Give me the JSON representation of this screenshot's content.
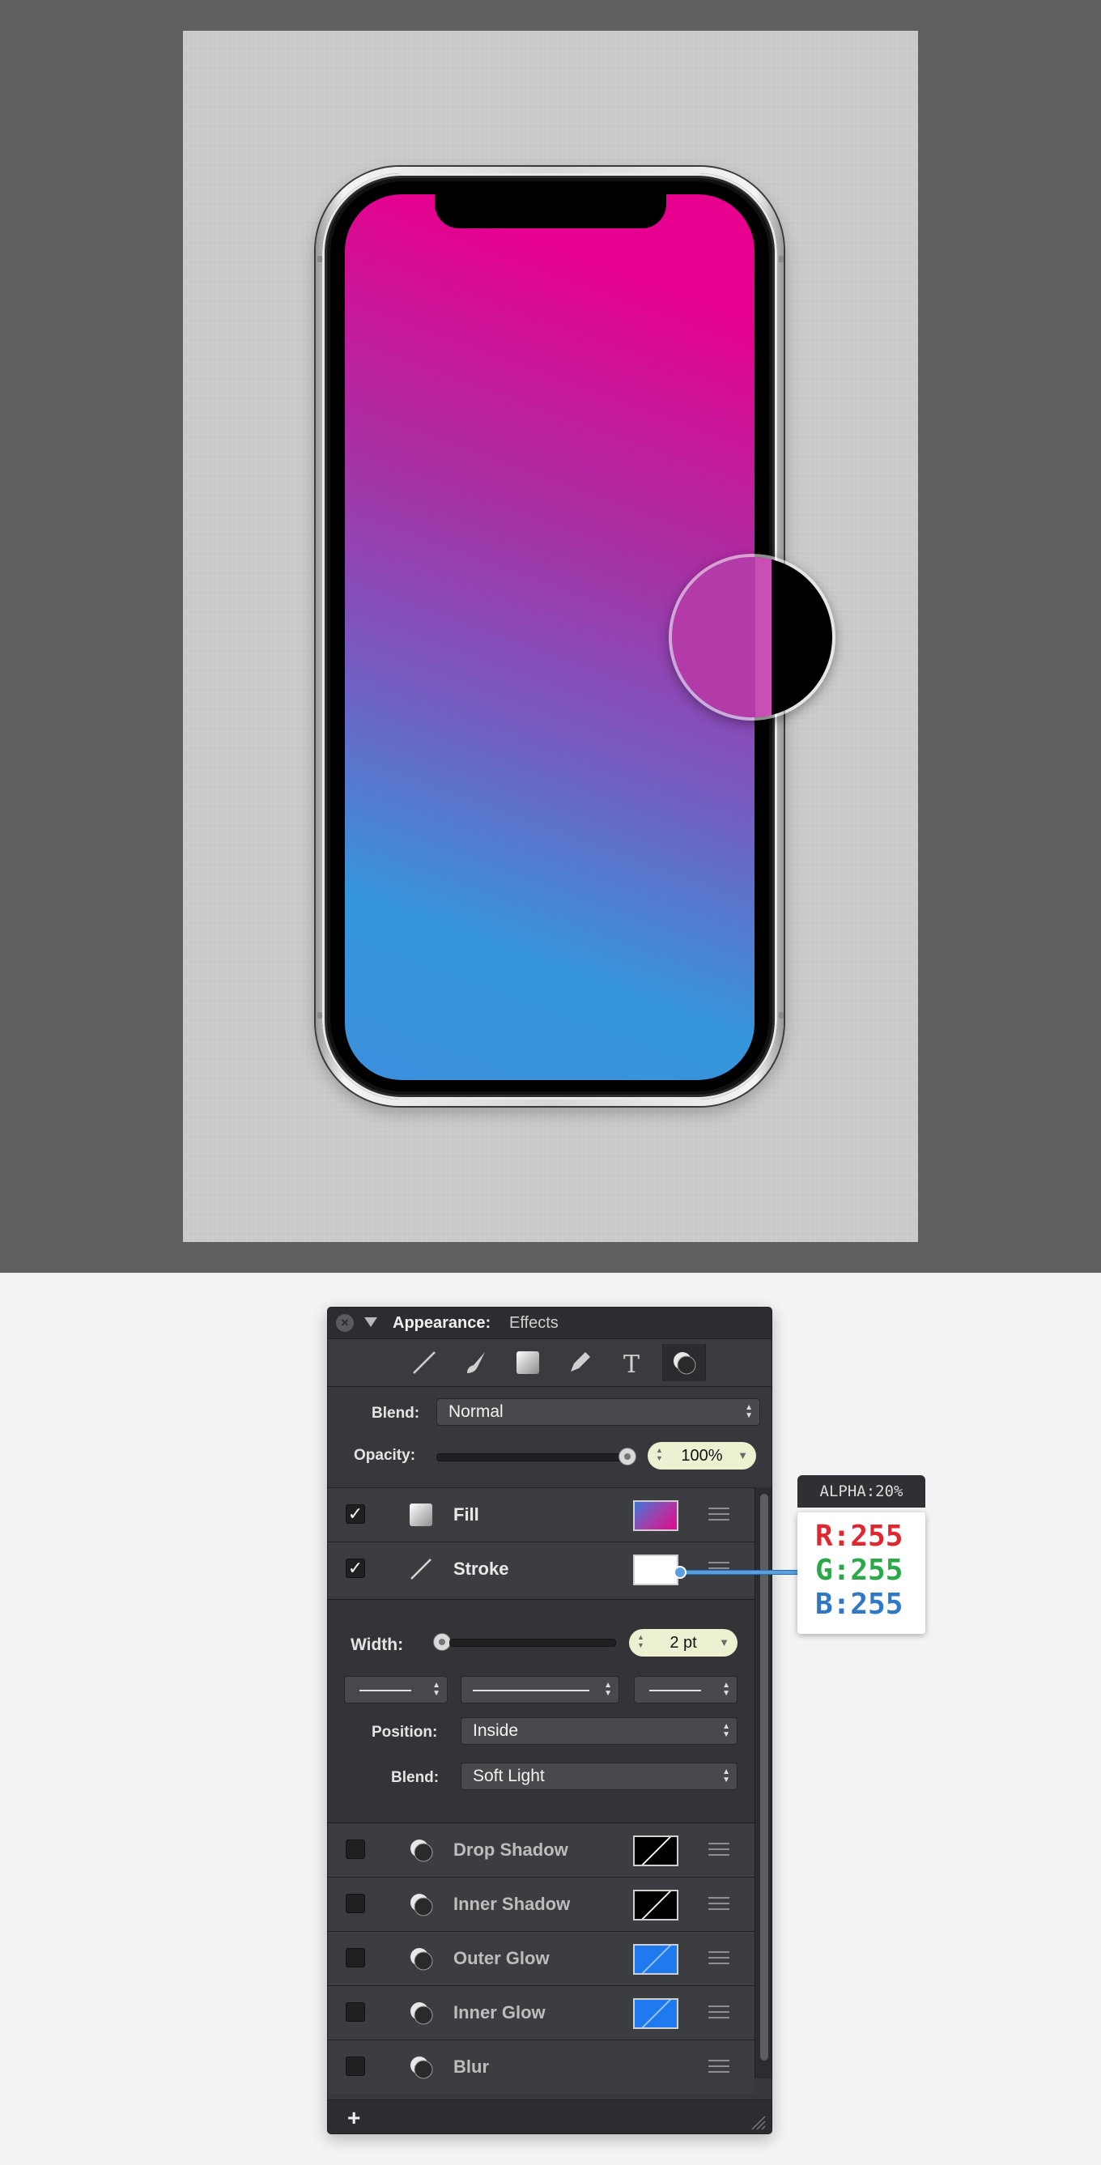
{
  "panel": {
    "title_label": "Appearance:",
    "title_value": "Effects",
    "tools": [
      "stroke-tool-icon",
      "brush-tool-icon",
      "fill-tool-icon",
      "pencil-tool-icon",
      "text-tool-icon",
      "effects-tool-icon"
    ],
    "blend_label": "Blend:",
    "blend_value": "Normal",
    "opacity_label": "Opacity:",
    "opacity_value": "100%",
    "opacity_level": 1.0,
    "rows": {
      "fill": {
        "name": "Fill",
        "checked": true
      },
      "stroke": {
        "name": "Stroke",
        "checked": true
      }
    },
    "stroke_settings": {
      "width_label": "Width:",
      "width_value": "2 pt",
      "width_level": 0.0,
      "position_label": "Position:",
      "position_value": "Inside",
      "blend_label": "Blend:",
      "blend_value": "Soft Light"
    },
    "effects": [
      {
        "name": "Drop Shadow",
        "checked": false
      },
      {
        "name": "Inner Shadow",
        "checked": false
      },
      {
        "name": "Outer Glow",
        "checked": false
      },
      {
        "name": "Inner Glow",
        "checked": false
      },
      {
        "name": "Blur",
        "checked": false
      }
    ],
    "add_label": "+"
  },
  "tooltip": {
    "alpha": "ALPHA:20%",
    "r": "R:255",
    "g": "G:255",
    "b": "B:255"
  },
  "colors": {
    "gradient_top": "#e6008f",
    "gradient_bottom": "#3596db",
    "r_color": "#e0262f",
    "g_color": "#2aa84a",
    "b_color": "#2f78c4",
    "glow_blue": "#1f7af0"
  }
}
